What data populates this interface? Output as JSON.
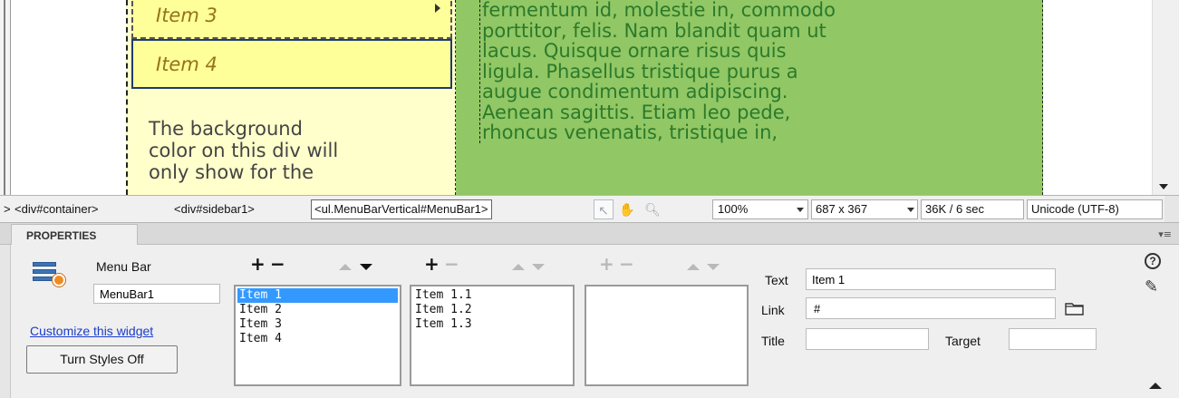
{
  "design": {
    "menu_items": [
      "Item 3",
      "Item 4"
    ],
    "sidebar_text": "The background\ncolor on this div will\nonly show for the",
    "main_text": "fermentum id, molestie in, commodo\nporttitor, felis. Nam blandit quam ut\nlacus. Quisque ornare risus quis\nligula. Phasellus tristique purus a\naugue condimentum adipiscing.\nAenean sagittis. Etiam leo pede,\nrhoncus venenatis, tristique in,"
  },
  "statusbar": {
    "tags": [
      "> ",
      "<div#container>",
      "<div#sidebar1>",
      "<ul.MenuBarVertical#MenuBar1>"
    ],
    "zoom": "100%",
    "window_size": "687 x 367",
    "download": "36K / 6 sec",
    "encoding": "Unicode (UTF-8)"
  },
  "properties": {
    "tab_label": "PROPERTIES",
    "widget_type": "Menu Bar",
    "widget_name": "MenuBar1",
    "customize_link": "Customize this widget",
    "styles_button": "Turn Styles Off",
    "list1": [
      "Item 1",
      "Item 2",
      "Item 3",
      "Item 4"
    ],
    "list1_selected": 0,
    "list2": [
      "Item 1.1",
      "Item 1.2",
      "Item 1.3"
    ],
    "list3": [],
    "text_label": "Text",
    "text_value": "Item 1",
    "link_label": "Link",
    "link_value": "#",
    "title_label": "Title",
    "title_value": "",
    "target_label": "Target",
    "target_value": "",
    "plus": "+",
    "minus": "−",
    "help": "?"
  },
  "icons": {
    "help": "help-icon",
    "edit": "edit-icon",
    "folder": "folder-icon",
    "widget": "menu-bar-widget-icon"
  },
  "colors": {
    "sidebar_bg": "#ffffcc",
    "menu_item_bg": "#ffff99",
    "main_bg": "#91c764",
    "main_text": "#2c7a2c",
    "list_selected": "#3399ff",
    "link": "#1a3cc8"
  }
}
